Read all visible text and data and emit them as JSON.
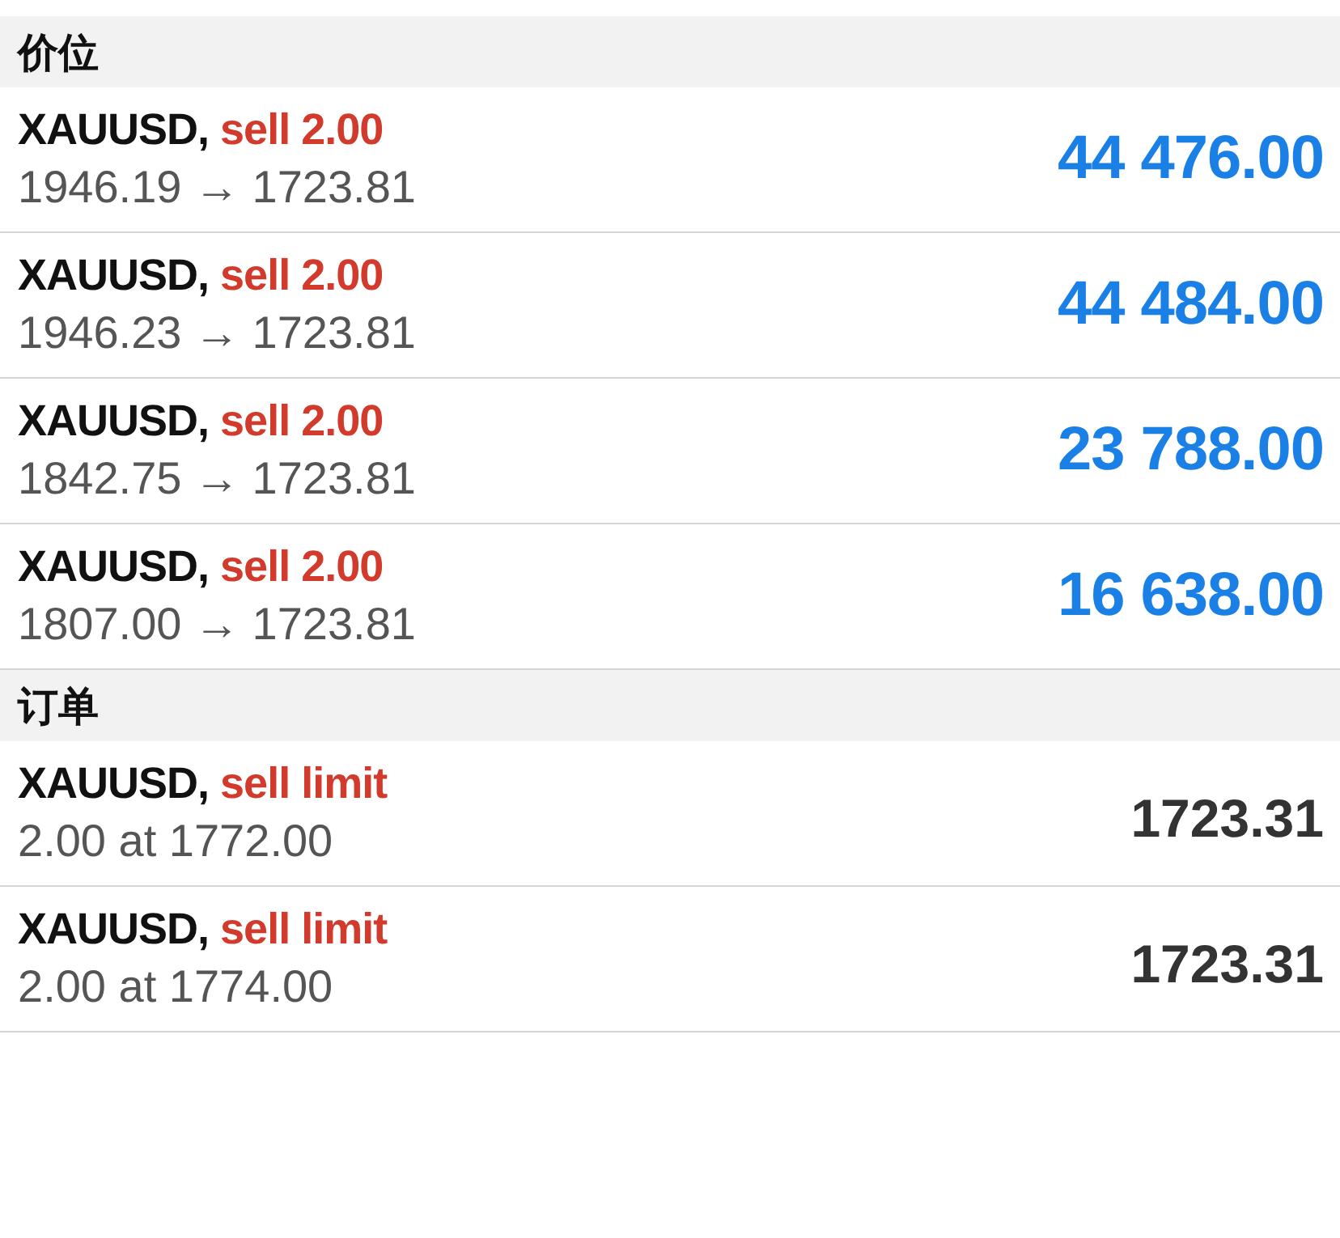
{
  "sections": [
    {
      "title": "价位",
      "kind": "positions",
      "items": [
        {
          "symbol": "XAUUSD,",
          "action": "sell 2.00",
          "detail": "1946.19 → 1723.81",
          "value": "44 476.00"
        },
        {
          "symbol": "XAUUSD,",
          "action": "sell 2.00",
          "detail": "1946.23 → 1723.81",
          "value": "44 484.00"
        },
        {
          "symbol": "XAUUSD,",
          "action": "sell 2.00",
          "detail": "1842.75 → 1723.81",
          "value": "23 788.00"
        },
        {
          "symbol": "XAUUSD,",
          "action": "sell 2.00",
          "detail": "1807.00 → 1723.81",
          "value": "16 638.00"
        }
      ]
    },
    {
      "title": "订单",
      "kind": "orders",
      "items": [
        {
          "symbol": "XAUUSD,",
          "action": "sell limit",
          "detail": "2.00 at 1772.00",
          "value": "1723.31"
        },
        {
          "symbol": "XAUUSD,",
          "action": "sell limit",
          "detail": "2.00 at 1774.00",
          "value": "1723.31"
        }
      ]
    }
  ]
}
